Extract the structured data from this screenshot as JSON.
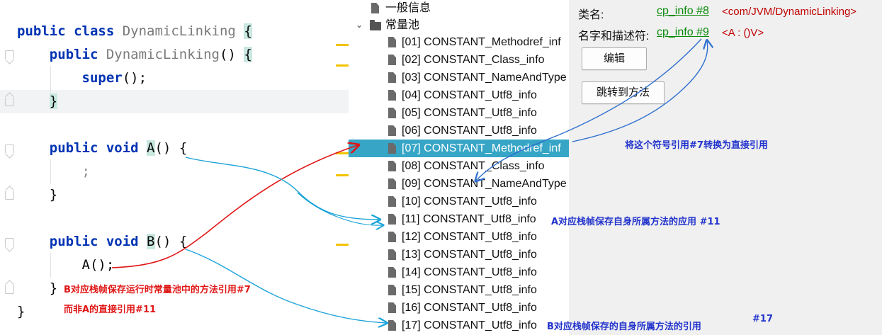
{
  "editor": {
    "lines": [
      {
        "tokens": [
          {
            "t": "public ",
            "c": "kw"
          },
          {
            "t": "class ",
            "c": "kw"
          },
          {
            "t": "DynamicLinking ",
            "c": "ident"
          },
          {
            "t": "{",
            "c": "bracehl"
          }
        ]
      },
      {
        "tokens": [
          {
            "t": "    "
          },
          {
            "t": "public ",
            "c": "kw"
          },
          {
            "t": "DynamicLinking",
            "c": "ident"
          },
          {
            "t": "() "
          },
          {
            "t": "{",
            "c": "bracehl"
          }
        ]
      },
      {
        "tokens": [
          {
            "t": "        "
          },
          {
            "t": "super",
            "c": "kw"
          },
          {
            "t": "();"
          }
        ]
      },
      {
        "tokens": [
          {
            "t": "    "
          },
          {
            "t": "}",
            "c": "bracehl"
          }
        ]
      },
      {
        "tokens": []
      },
      {
        "tokens": [
          {
            "t": "    "
          },
          {
            "t": "public ",
            "c": "kw"
          },
          {
            "t": "void ",
            "c": "kw"
          },
          {
            "t": "A",
            "c": "bracehl"
          },
          {
            "t": "() "
          },
          {
            "t": "{",
            "c": "name"
          }
        ]
      },
      {
        "tokens": [
          {
            "t": "        "
          },
          {
            "t": ";",
            "c": "ghost"
          }
        ]
      },
      {
        "tokens": [
          {
            "t": "    "
          },
          {
            "t": "}"
          }
        ]
      },
      {
        "tokens": []
      },
      {
        "tokens": [
          {
            "t": "    "
          },
          {
            "t": "public ",
            "c": "kw"
          },
          {
            "t": "void ",
            "c": "kw"
          },
          {
            "t": "B",
            "c": "bracehl"
          },
          {
            "t": "() "
          },
          {
            "t": "{",
            "c": "name"
          }
        ]
      },
      {
        "tokens": [
          {
            "t": "        "
          },
          {
            "t": "A();"
          }
        ]
      },
      {
        "tokens": [
          {
            "t": "    "
          },
          {
            "t": "}"
          }
        ]
      },
      {
        "tokens": [
          {
            "t": "}"
          }
        ]
      }
    ]
  },
  "tree": {
    "general_info": "一般信息",
    "constant_pool": "常量池",
    "items": [
      "[01] CONSTANT_Methodref_inf",
      "[02] CONSTANT_Class_info",
      "[03] CONSTANT_NameAndType",
      "[04] CONSTANT_Utf8_info",
      "[05] CONSTANT_Utf8_info",
      "[06] CONSTANT_Utf8_info",
      "[07] CONSTANT_Methodref_inf",
      "[08] CONSTANT_Class_info",
      "[09] CONSTANT_NameAndType",
      "[10] CONSTANT_Utf8_info",
      "[11] CONSTANT_Utf8_info",
      "[12] CONSTANT_Utf8_info",
      "[13] CONSTANT_Utf8_info",
      "[14] CONSTANT_Utf8_info",
      "[15] CONSTANT_Utf8_info",
      "[16] CONSTANT_Utf8_info",
      "[17] CONSTANT_Utf8_info"
    ],
    "selected_index": 6
  },
  "detail": {
    "class_name_label": "类名:",
    "class_name_link": "cp_info #8",
    "class_name_value": "<com/JVM/DynamicLinking>",
    "name_desc_label": "名字和描述符:",
    "name_desc_link": "cp_info #9",
    "name_desc_value": "<A : ()V>",
    "edit_button": "编辑",
    "goto_button": "跳转到方法"
  },
  "annotations": {
    "b_frame_line1": "B对应栈帧保存运行时常量池中的方法引用#7",
    "b_frame_line2": "而非A的直接引用#11",
    "convert_note": "将这个符号引用#7转换为直接引用",
    "a_frame_note": "A对应栈帧保存自身所属方法的应用 #11",
    "b_frame_self": "B对应栈帧保存的自身所属方法的引用",
    "b_frame_self_num": "#17"
  },
  "colors": {
    "keyword": "#0033b3",
    "selection": "#36a5c6",
    "link": "#0a8a0a",
    "value": "#c00000",
    "red_arrow": "#e01515",
    "blue_arrow": "#2f6fd0",
    "cyan_arrow": "#1aa3d8"
  }
}
